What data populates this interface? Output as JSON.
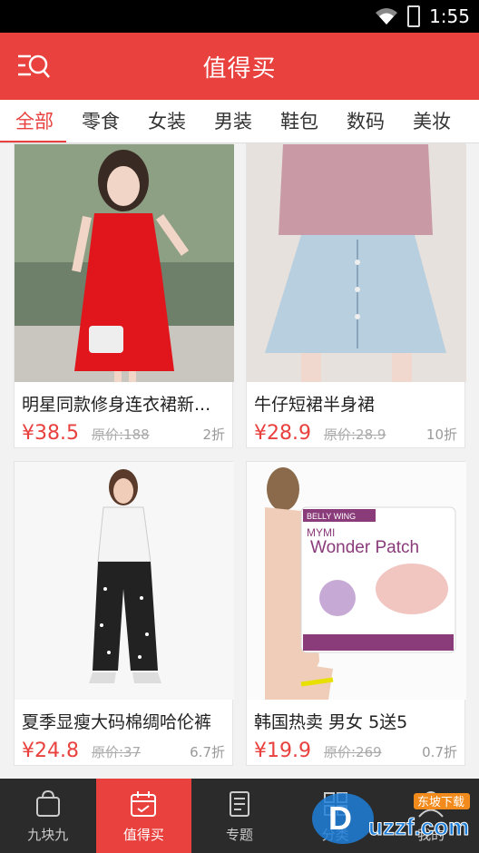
{
  "status": {
    "time": "1:55"
  },
  "header": {
    "title": "值得买",
    "menu_icon": "search-menu-icon"
  },
  "tabs": [
    "全部",
    "零食",
    "女装",
    "男装",
    "鞋包",
    "数码",
    "美妆"
  ],
  "products": [
    {
      "name": "明星同款修身连衣裙新...",
      "price": "¥38.5",
      "original": "原价:188",
      "discount": "2折"
    },
    {
      "name": "牛仔短裙半身裙",
      "price": "¥28.9",
      "original": "原价:28.9",
      "discount": "10折"
    },
    {
      "name": "夏季显瘦大码棉绸哈伦裤",
      "price": "¥24.8",
      "original": "原价:37",
      "discount": "6.7折"
    },
    {
      "name": "韩国热卖 男女 5送5",
      "price": "¥19.9",
      "original": "原价:269",
      "discount": "0.7折"
    }
  ],
  "product_images": {
    "patch_brand": "BELLY WING",
    "patch_line1": "MYMI",
    "patch_title": "Wonder Patch"
  },
  "bottom_nav": [
    {
      "label": "九块九",
      "icon": "shopping-bag-icon"
    },
    {
      "label": "值得买",
      "icon": "calendar-icon"
    },
    {
      "label": "专题",
      "icon": "document-icon"
    },
    {
      "label": "分类",
      "icon": "grid-icon"
    },
    {
      "label": "我的",
      "icon": "user-icon"
    }
  ],
  "watermark": {
    "text": "uzzf.com",
    "subtitle": "东坡下载"
  },
  "colors": {
    "accent": "#e8413e",
    "bottom_bar": "#2b2b2b"
  }
}
